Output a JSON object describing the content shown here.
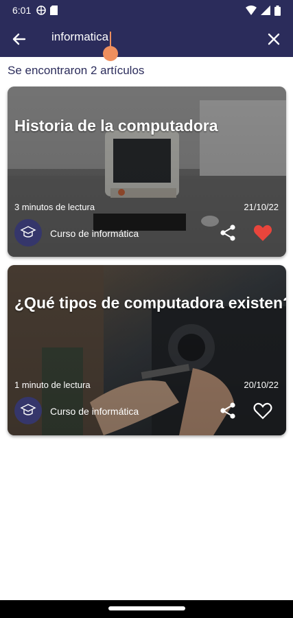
{
  "status_bar": {
    "time": "6:01",
    "icons_left": [
      "vpn-icon",
      "sd-card-icon"
    ],
    "icons_right": [
      "wifi-icon",
      "signal-icon",
      "battery-icon"
    ]
  },
  "app_bar": {
    "search_value": "informatica",
    "back_icon": "arrow-back-icon",
    "close_icon": "close-icon",
    "background_color": "#2b2c5b",
    "cursor_color": "#ef8f5e"
  },
  "results_label": "Se encontraron 2 artículos",
  "articles": [
    {
      "title": "Historia de la computadora",
      "read_time": "3 minutos de lectura",
      "date": "21/10/22",
      "author": "Curso de informática",
      "favorite": true,
      "favorite_color": "#e8453c"
    },
    {
      "title": "¿Qué tipos de computadora existen?",
      "read_time": "1 minuto de lectura",
      "date": "20/10/22",
      "author": "Curso de informática",
      "favorite": false
    }
  ]
}
